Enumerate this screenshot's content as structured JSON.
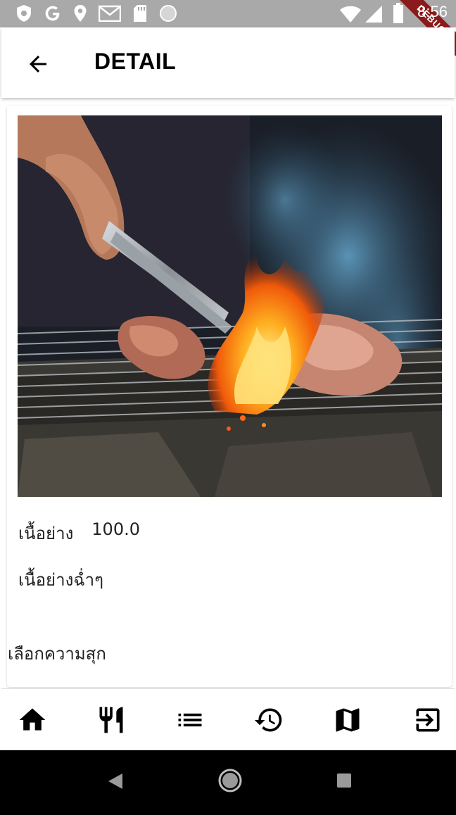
{
  "status_bar": {
    "time": "8:56",
    "debug_label": "DEBUG",
    "left_icons": [
      "shield-icon",
      "google-icon",
      "location-icon",
      "gmail-icon",
      "sdcard-icon",
      "circle-icon"
    ],
    "right_icons": [
      "wifi-icon",
      "signal-icon",
      "battery-icon"
    ]
  },
  "app_bar": {
    "title": "DETAIL",
    "back_icon": "arrow-back-icon"
  },
  "detail": {
    "name": "เนื้อย่าง",
    "price": "100.0",
    "description": "เนื้อย่างฉ่ำๆ",
    "choose_label": "เลือกความสุก"
  },
  "bottom_nav": {
    "items": [
      "home-icon",
      "restaurant-icon",
      "list-icon",
      "history-icon",
      "map-icon",
      "exit-icon"
    ]
  },
  "system_nav": [
    "back-triangle-icon",
    "home-circle-icon",
    "recents-square-icon"
  ]
}
